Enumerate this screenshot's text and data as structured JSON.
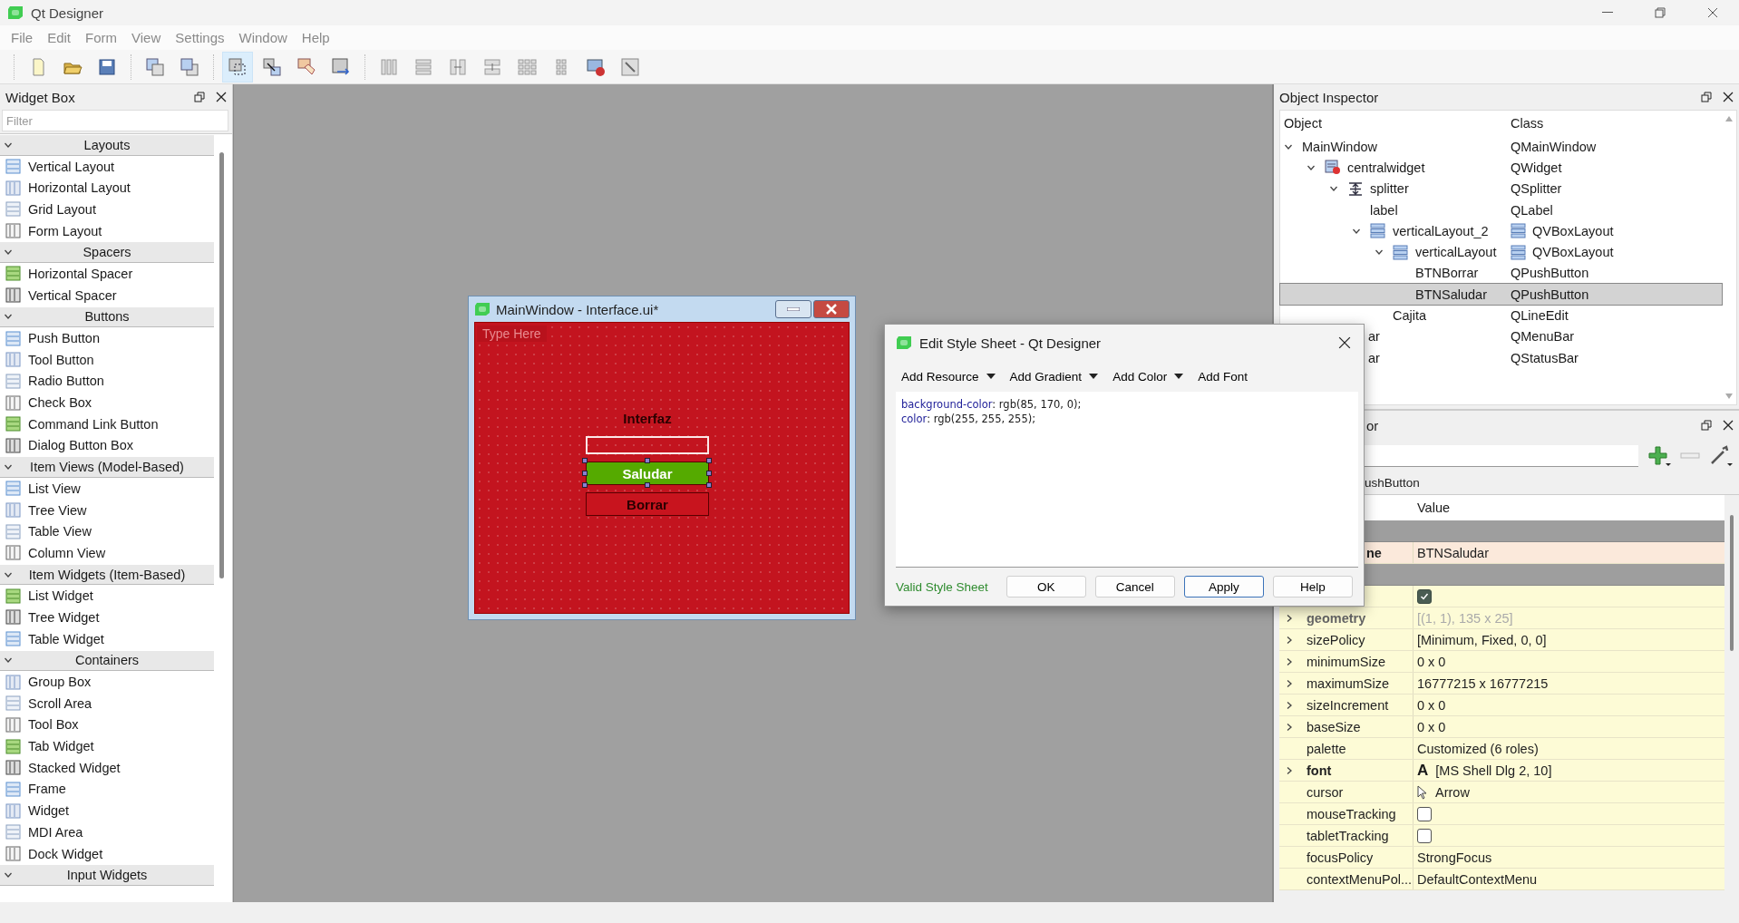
{
  "window": {
    "title": "Qt Designer"
  },
  "menu": [
    "File",
    "Edit",
    "Form",
    "View",
    "Settings",
    "Window",
    "Help"
  ],
  "toolbar": [
    [
      {
        "kind": "new",
        "selected": false
      },
      {
        "kind": "open",
        "selected": false
      },
      {
        "kind": "save",
        "selected": false
      }
    ],
    [
      {
        "kind": "back",
        "selected": false
      },
      {
        "kind": "front",
        "selected": false
      }
    ],
    [
      {
        "kind": "edit-widgets",
        "selected": true
      },
      {
        "kind": "edit-signals",
        "selected": false
      },
      {
        "kind": "edit-buddies",
        "selected": false
      },
      {
        "kind": "edit-taborder",
        "selected": false
      }
    ],
    [
      {
        "kind": "layout-h",
        "selected": false
      },
      {
        "kind": "layout-v",
        "selected": false
      },
      {
        "kind": "split-h",
        "selected": false
      },
      {
        "kind": "split-v",
        "selected": false
      },
      {
        "kind": "layout-grid",
        "selected": false
      },
      {
        "kind": "layout-form",
        "selected": false
      },
      {
        "kind": "break-layout",
        "selected": false
      },
      {
        "kind": "adjust-size",
        "selected": false
      }
    ]
  ],
  "widget_box": {
    "title": "Widget Box",
    "filter_placeholder": "Filter",
    "categories": [
      {
        "name": "Layouts",
        "expanded": true,
        "items": [
          "Vertical Layout",
          "Horizontal Layout",
          "Grid Layout",
          "Form Layout"
        ]
      },
      {
        "name": "Spacers",
        "expanded": true,
        "items": [
          "Horizontal Spacer",
          "Vertical Spacer"
        ]
      },
      {
        "name": "Buttons",
        "expanded": true,
        "items": [
          "Push Button",
          "Tool Button",
          "Radio Button",
          "Check Box",
          "Command Link Button",
          "Dialog Button Box"
        ]
      },
      {
        "name": "Item Views (Model-Based)",
        "expanded": true,
        "items": [
          "List View",
          "Tree View",
          "Table View",
          "Column View"
        ]
      },
      {
        "name": "Item Widgets (Item-Based)",
        "expanded": true,
        "items": [
          "List Widget",
          "Tree Widget",
          "Table Widget"
        ]
      },
      {
        "name": "Containers",
        "expanded": true,
        "items": [
          "Group Box",
          "Scroll Area",
          "Tool Box",
          "Tab Widget",
          "Stacked Widget",
          "Frame",
          "Widget",
          "MDI Area",
          "Dock Widget"
        ]
      },
      {
        "name": "Input Widgets",
        "expanded": true
      }
    ]
  },
  "form_window": {
    "title": "MainWindow - Interface.ui*",
    "menu_placeholder": "Type Here",
    "label": "Interfaz",
    "buttons": [
      {
        "text": "Saludar",
        "color": "#55aa00",
        "selected": true
      },
      {
        "text": "Borrar",
        "color": "#c8141e",
        "selected": false
      }
    ]
  },
  "dialog": {
    "title": "Edit Style Sheet - Qt Designer",
    "toolbar": [
      {
        "label": "Add Resource",
        "menu": true
      },
      {
        "label": "Add Gradient",
        "menu": true
      },
      {
        "label": "Add Color",
        "menu": true
      },
      {
        "label": "Add Font",
        "menu": false
      }
    ],
    "code": [
      {
        "property": "background-color",
        "value": ": rgb(85, 170, 0);"
      },
      {
        "property": "color",
        "value": ": rgb(255, 255, 255);"
      }
    ],
    "status": "Valid Style Sheet",
    "buttons": [
      {
        "label": "OK",
        "default": false
      },
      {
        "label": "Cancel",
        "default": false
      },
      {
        "label": "Apply",
        "default": true
      },
      {
        "label": "Help",
        "default": false
      }
    ]
  },
  "object_inspector": {
    "title": "Object Inspector",
    "columns": [
      "Object",
      "Class"
    ],
    "tree": [
      {
        "name": "MainWindow",
        "class": "QMainWindow",
        "kind": "plain",
        "selected": false,
        "expanded": true,
        "children": [
          {
            "name": "centralwidget",
            "class": "QWidget",
            "kind": "widget",
            "selected": false,
            "partial": false,
            "expanded": true,
            "children": [
              {
                "name": "splitter",
                "class": "QSplitter",
                "kind": "splitter",
                "selected": false,
                "partial": false,
                "expanded": true,
                "children": [
                  {
                    "name": "label",
                    "class": "QLabel",
                    "kind": "plain",
                    "selected": false,
                    "partial": false
                  },
                  {
                    "name": "verticalLayout_2",
                    "class": "QVBoxLayout",
                    "kind": "layout",
                    "selected": false,
                    "partial": false,
                    "expanded": true,
                    "children": [
                      {
                        "name": "verticalLayout",
                        "class": "QVBoxLayout",
                        "kind": "layout",
                        "selected": false,
                        "partial": false,
                        "expanded": true,
                        "children": [
                          {
                            "name": "BTNBorrar",
                            "class": "QPushButton",
                            "kind": "plain",
                            "selected": false,
                            "partial": false
                          },
                          {
                            "name": "BTNSaludar",
                            "class": "QPushButton",
                            "kind": "plain",
                            "selected": true,
                            "partial": false
                          }
                        ]
                      },
                      {
                        "name": "Cajita",
                        "class": "QLineEdit",
                        "kind": "plain",
                        "selected": false,
                        "partial": false
                      }
                    ]
                  }
                ]
              }
            ]
          },
          {
            "name": "ar",
            "class": "QMenuBar",
            "kind": "plain",
            "selected": false,
            "partial": true
          },
          {
            "name": "ar",
            "class": "QStatusBar",
            "kind": "plain",
            "selected": false,
            "partial": true
          }
        ]
      }
    ]
  },
  "property_editor": {
    "title": "or",
    "class_line": "ushButton",
    "columns": [
      "Value"
    ],
    "groups": [
      {
        "color": "#fbe9db",
        "properties": [
          {
            "name": "ne",
            "partial": true,
            "kind": "text",
            "value": "BTNSaludar",
            "modified": true,
            "disabled": false
          }
        ]
      },
      {
        "color": "#fdfbd6",
        "properties": [
          {
            "kind": "check",
            "checked": true
          },
          {
            "name": "geometry",
            "partial": false,
            "kind": "text",
            "value": "[(1, 1), 135 x 25]",
            "expandable": true,
            "modified": true,
            "disabled": true
          },
          {
            "name": "sizePolicy",
            "partial": false,
            "kind": "text",
            "value": "[Minimum, Fixed, 0, 0]",
            "expandable": true,
            "modified": false,
            "disabled": false
          },
          {
            "name": "minimumSize",
            "partial": false,
            "kind": "text",
            "value": "0 x 0",
            "expandable": true,
            "modified": false,
            "disabled": false
          },
          {
            "name": "maximumSize",
            "partial": false,
            "kind": "text",
            "value": "16777215 x 16777215",
            "expandable": true,
            "modified": false,
            "disabled": false
          },
          {
            "name": "sizeIncrement",
            "partial": false,
            "kind": "text",
            "value": "0 x 0",
            "expandable": true,
            "modified": false,
            "disabled": false
          },
          {
            "name": "baseSize",
            "partial": false,
            "kind": "text",
            "value": "0 x 0",
            "expandable": true,
            "modified": false,
            "disabled": false
          },
          {
            "name": "palette",
            "partial": false,
            "kind": "text",
            "value": "Customized (6 roles)",
            "expandable": false,
            "modified": false,
            "disabled": false
          },
          {
            "name": "font",
            "partial": false,
            "kind": "font",
            "icon": "A",
            "value": "[MS Shell Dlg 2, 10]",
            "expandable": true,
            "modified": true,
            "disabled": false
          },
          {
            "name": "cursor",
            "partial": false,
            "kind": "cursor",
            "value": "Arrow",
            "expandable": false,
            "modified": false,
            "disabled": false
          },
          {
            "name": "mouseTracking",
            "partial": false,
            "kind": "check",
            "checked": false,
            "expandable": false,
            "modified": false,
            "disabled": false
          },
          {
            "name": "tabletTracking",
            "partial": false,
            "kind": "check",
            "checked": false,
            "expandable": false,
            "modified": false,
            "disabled": false
          },
          {
            "name": "focusPolicy",
            "partial": false,
            "kind": "text",
            "value": "StrongFocus",
            "expandable": false,
            "modified": false,
            "disabled": false
          },
          {
            "name": "contextMenuPol...",
            "partial": false,
            "kind": "text",
            "value": "DefaultContextMenu",
            "expandable": false,
            "modified": false,
            "disabled": false
          }
        ]
      }
    ]
  }
}
